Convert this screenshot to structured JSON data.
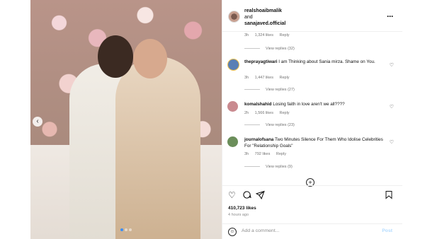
{
  "post": {
    "carousel_prev_icon": "chevron-left-icon",
    "carousel_dots": 3
  },
  "header": {
    "author1": "realshoaibmalik",
    "and_text": "and",
    "author2": "sanajaved.official",
    "more_icon": "more-dots-icon"
  },
  "top_meta": {
    "time": "3h",
    "likes": "1,324 likes",
    "reply": "Reply"
  },
  "top_view_replies": "View replies (32)",
  "comments": [
    {
      "user": "theprayagtiwari",
      "text": "I am Thinking about Sania mirza. Shame on You.",
      "time": "3h",
      "likes": "1,447 likes",
      "reply": "Reply",
      "view_replies": "View replies (27)",
      "avatar_color": "#5a7fb5"
    },
    {
      "user": "komalshahid",
      "text": "Losing faith in love aren't we all????",
      "time": "2h",
      "likes": "1,566 likes",
      "reply": "Reply",
      "view_replies": "View replies (23)",
      "avatar_color": "#c98a8f"
    },
    {
      "user": "journalofsana",
      "text": "Two Minutes Silence For Them Who Idolise Celebrities For \"Relationship Goals\"",
      "time": "3h",
      "likes": "792 likes",
      "reply": "Reply",
      "view_replies": "View replies (9)",
      "avatar_color": "#6b8e5a"
    }
  ],
  "actions": {
    "like_icon": "heart-icon",
    "comment_icon": "comment-icon",
    "share_icon": "share-icon",
    "save_icon": "bookmark-icon"
  },
  "likes_total": "410,723 likes",
  "posted_time": "4 hours ago",
  "add_comment": {
    "placeholder": "Add a comment...",
    "post_label": "Post",
    "emoji_icon": "emoji-icon"
  },
  "colors": {
    "link_disabled": "#b3dbff",
    "muted": "#737373",
    "active_dot": "#3a8df5"
  }
}
